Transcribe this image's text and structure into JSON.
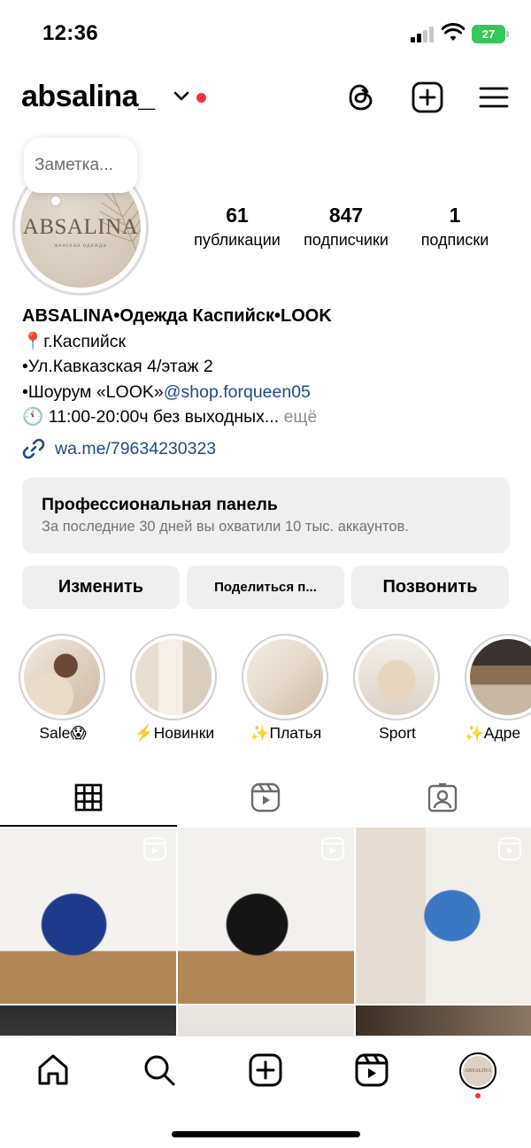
{
  "status_bar": {
    "time": "12:36",
    "battery": "27"
  },
  "header": {
    "username": "absalina_"
  },
  "note": {
    "placeholder": "Заметка..."
  },
  "avatar": {
    "brand": "ABSALINA",
    "tagline": "женская одежда"
  },
  "stats": [
    {
      "value": "61",
      "label": "публикации"
    },
    {
      "value": "847",
      "label": "подписчики"
    },
    {
      "value": "1",
      "label": "подписки"
    }
  ],
  "bio": {
    "name": "ABSALINA•Одежда Каспийск•LOOK",
    "line1": "📍г.Каспийск",
    "line2": "•Ул.Кавказская 4/этаж 2",
    "line3_prefix": "•Шоурум «LOOK»",
    "line3_mention": "@shop.forqueen05",
    "line4": "🕚 11:00-20:00ч без выходных...",
    "more": "ещё",
    "link": "wa.me/79634230323"
  },
  "pro_panel": {
    "title": "Профессиональная панель",
    "subtitle": "За последние 30 дней вы охватили 10 тыс. аккаунтов."
  },
  "buttons": {
    "edit": "Изменить",
    "share": "Поделиться п...",
    "call": "Позвонить"
  },
  "highlights": [
    {
      "label": "Sale😱"
    },
    {
      "label": "⚡️Новинки"
    },
    {
      "label": "✨Платья"
    },
    {
      "label": "Sport"
    },
    {
      "label": "✨Адре"
    }
  ],
  "colors": {
    "accent_red": "#ff3040",
    "link_blue": "#1c4a8c",
    "battery_green": "#34c759",
    "panel_gray": "#efefef"
  }
}
